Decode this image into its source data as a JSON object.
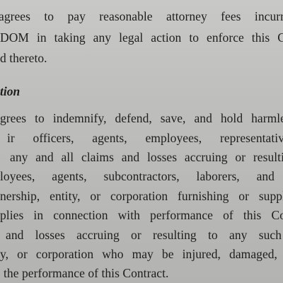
{
  "document": {
    "paragraph1": [
      " agrees to pay reasonable attorney fees incurr",
      "DOM in taking any legal action to enforce this C",
      "d thereto."
    ],
    "section_heading": "tion",
    "paragraph2": [
      "grees to indemnify, defend, save, and hold harmle",
      "ir officers, agents, employees, representativ",
      "any and all claims and losses accruing or resulti",
      "loyees, agents, subcontractors, laborers, and",
      "nership, entity, or corporation furnishing or suppl",
      "plies in connection with performance of this Co",
      "and losses accruing or resulting to any such",
      "y, or corporation who may be injured, damaged,",
      "the performance of this Contract."
    ]
  }
}
